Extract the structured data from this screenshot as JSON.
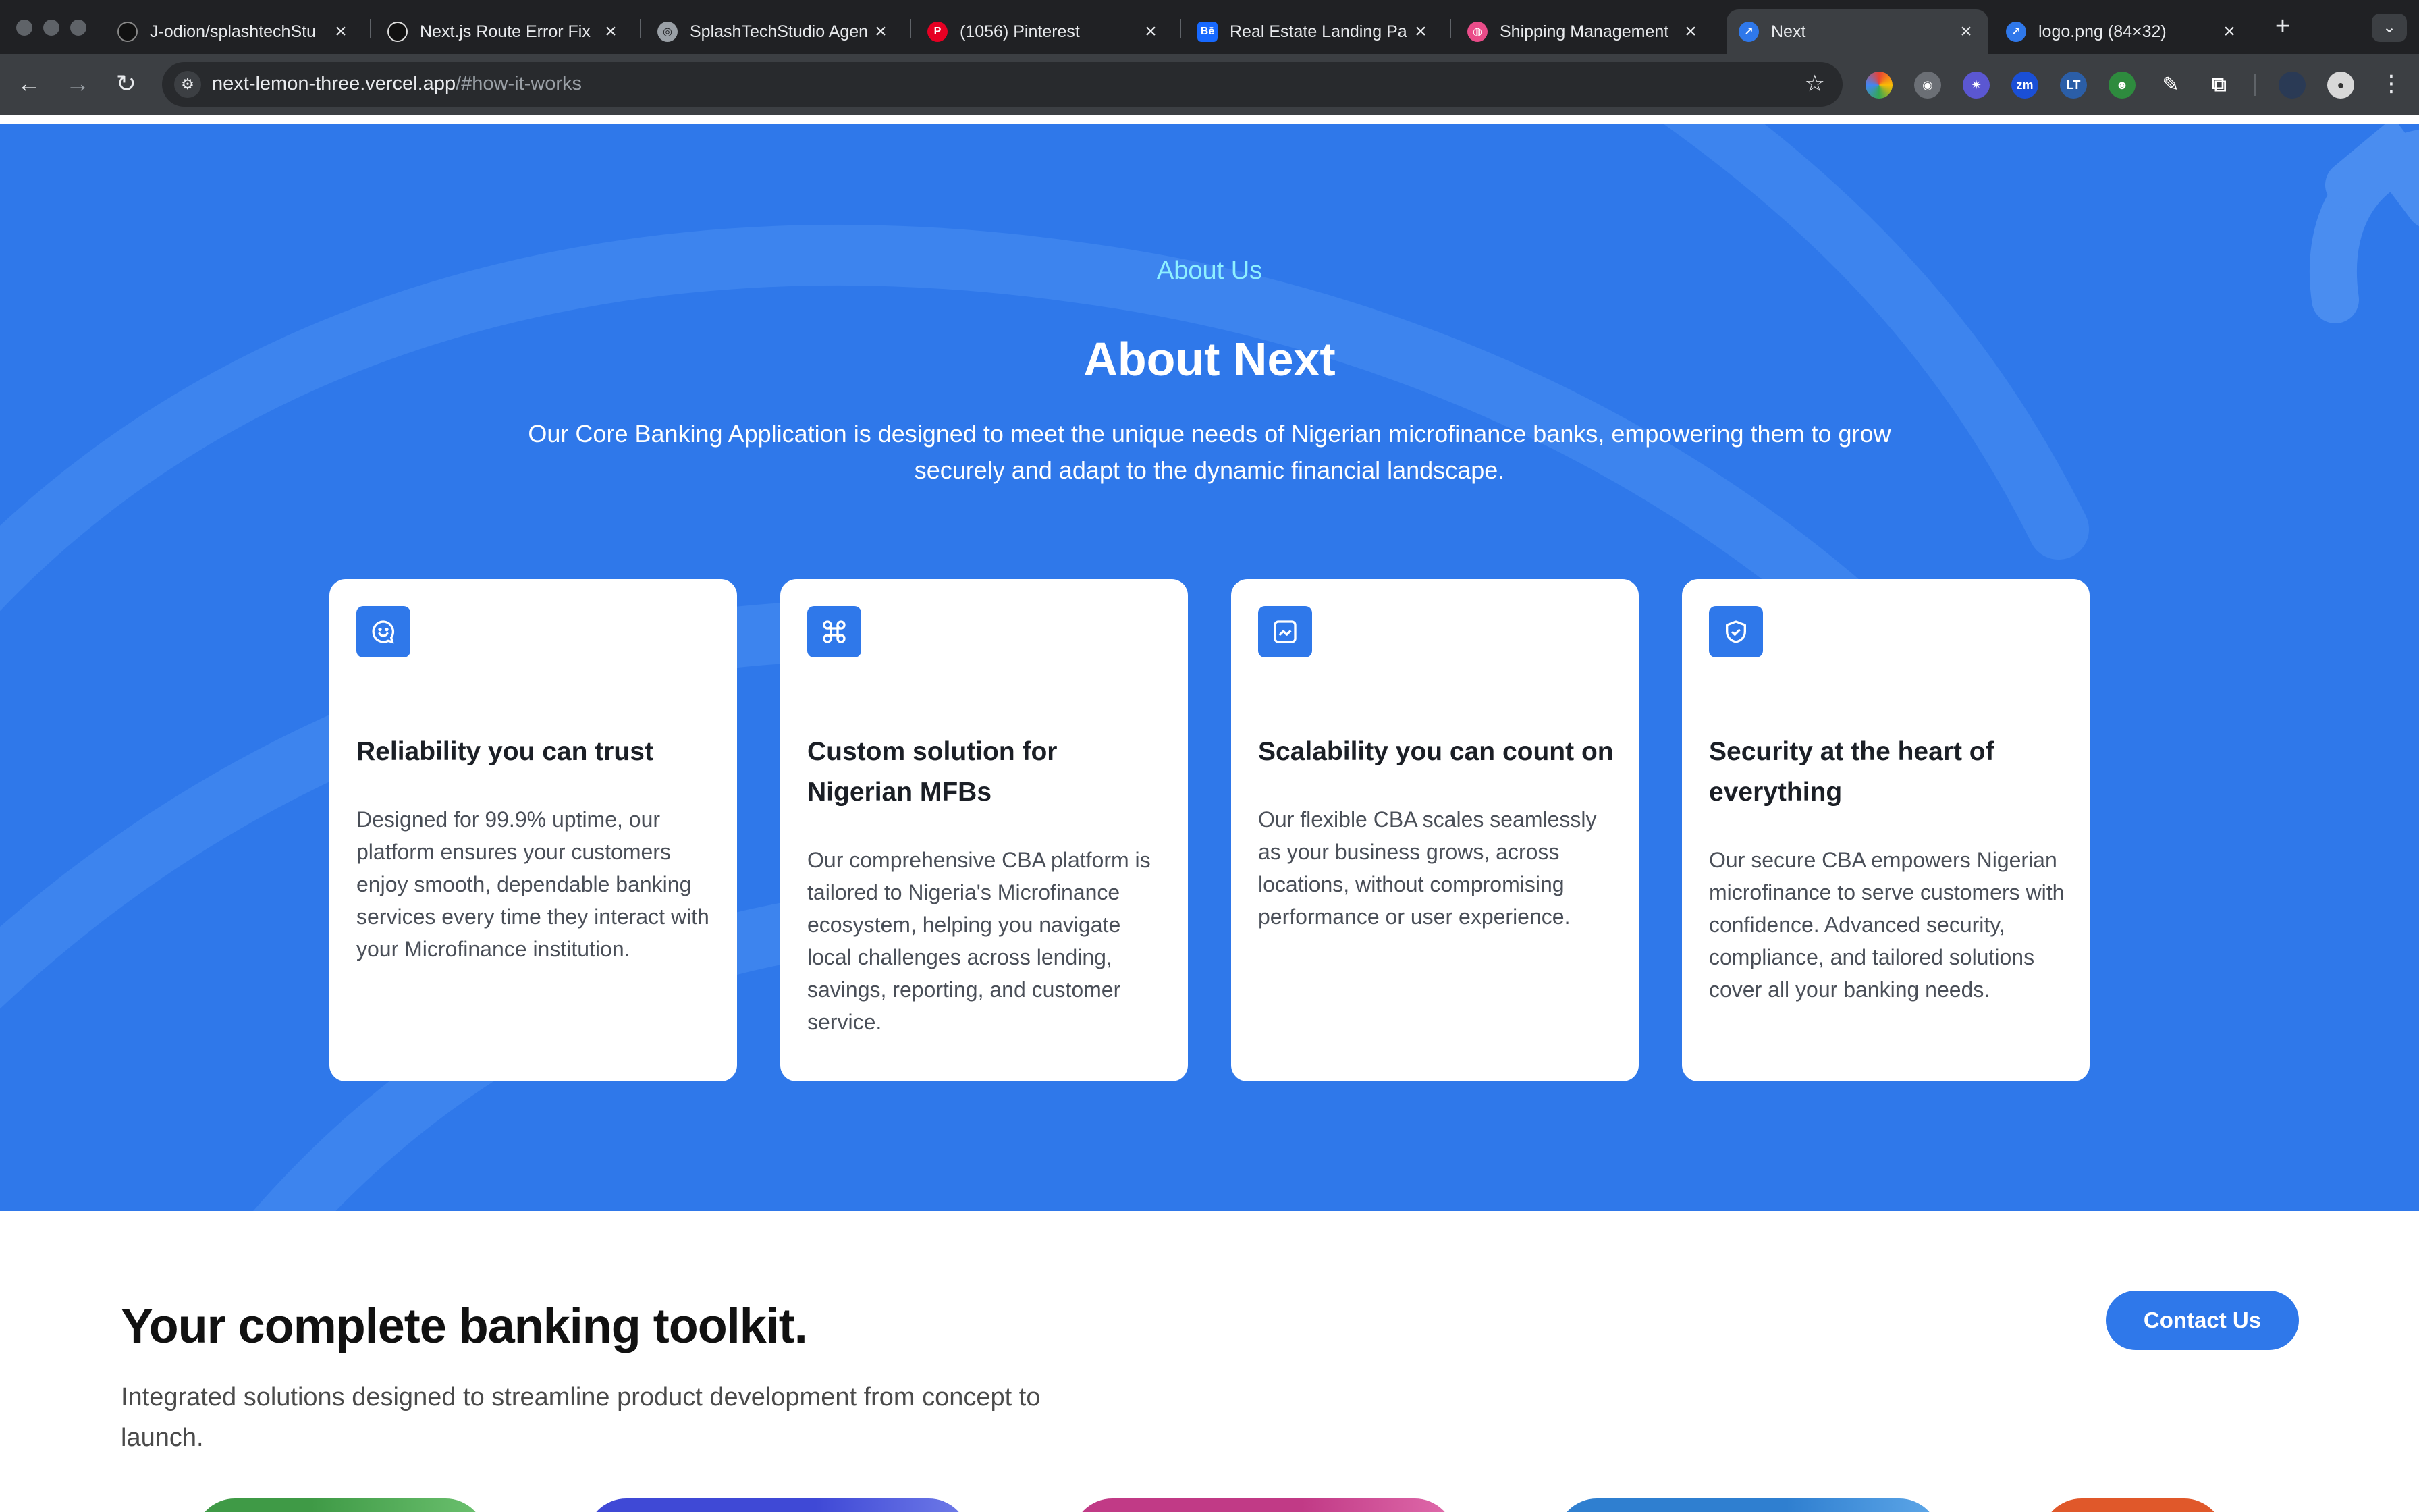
{
  "browser": {
    "tabs": [
      {
        "title": "J-odion/splashtechStu",
        "icon": "github-icon",
        "active": false
      },
      {
        "title": "Next.js Route Error Fix",
        "icon": "chatgpt-icon",
        "active": false
      },
      {
        "title": "SplashTechStudio Agen",
        "icon": "globe-icon",
        "active": false
      },
      {
        "title": "(1056) Pinterest",
        "icon": "pinterest-icon",
        "active": false
      },
      {
        "title": "Real Estate Landing Pa",
        "icon": "behance-icon",
        "active": false
      },
      {
        "title": "Shipping Management",
        "icon": "dribbble-icon",
        "active": false
      },
      {
        "title": "Next",
        "icon": "next-logo-icon",
        "active": true
      },
      {
        "title": "logo.png (84×32)",
        "icon": "next-logo-icon",
        "active": false
      }
    ],
    "url_host": "next-lemon-three.vercel.app",
    "url_path": "/#how-it-works",
    "colors": {
      "tabstrip": "#202124",
      "toolbar": "#3c3f43",
      "omnibox": "#282a2d"
    }
  },
  "about": {
    "eyebrow": "About Us",
    "title": "About Next",
    "description": "Our Core Banking Application is designed to meet the unique needs of Nigerian microfinance banks, empowering them to grow securely and adapt to the dynamic financial landscape.",
    "cards": [
      {
        "icon": "chat-smile-icon",
        "title": "Reliability you can trust",
        "text": "Designed for 99.9% uptime, our platform ensures your customers enjoy smooth, dependable banking services every time they interact with your Microfinance institution."
      },
      {
        "icon": "command-icon",
        "title": "Custom solution for Nigerian MFBs",
        "text": "Our comprehensive CBA platform is tailored to Nigeria's Microfinance ecosystem, helping you navigate local challenges across lending, savings, reporting, and customer service."
      },
      {
        "icon": "chart-growth-icon",
        "title": "Scalability you can count on",
        "text": "Our flexible CBA scales seamlessly as your business grows, across locations, without compromising performance or user experience."
      },
      {
        "icon": "shield-check-icon",
        "title": "Security at the heart of everything",
        "text": "Our secure CBA empowers Nigerian microfinance to serve customers with confidence. Advanced security, compliance, and tailored solutions cover all your banking needs."
      }
    ],
    "colors": {
      "background": "#2f78ea",
      "eyebrow": "#8ef0ff",
      "icon_bg": "#2f78ea"
    }
  },
  "toolkit": {
    "title": "Your complete banking toolkit.",
    "description": "Integrated solutions designed to streamline product development from concept to launch.",
    "cta": "Contact Us",
    "pill_colors": [
      "#3f9a46",
      "#3f49d6",
      "#c13a86",
      "#2f7fd0",
      "#e0582a"
    ]
  }
}
